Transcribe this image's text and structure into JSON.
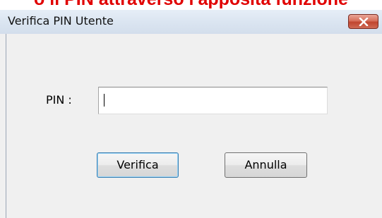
{
  "banner": {
    "text": "o il PIN attraverso l'apposita funzione"
  },
  "window": {
    "title": "Verifica PIN Utente",
    "close_icon": "close-icon"
  },
  "form": {
    "pin_label": "PIN :",
    "pin_value": ""
  },
  "buttons": {
    "verify_label": "Verifica",
    "cancel_label": "Annulla"
  },
  "colors": {
    "banner_text": "#e00000",
    "close_button": "#c0452f",
    "dialog_background": "#f0f0f0"
  }
}
